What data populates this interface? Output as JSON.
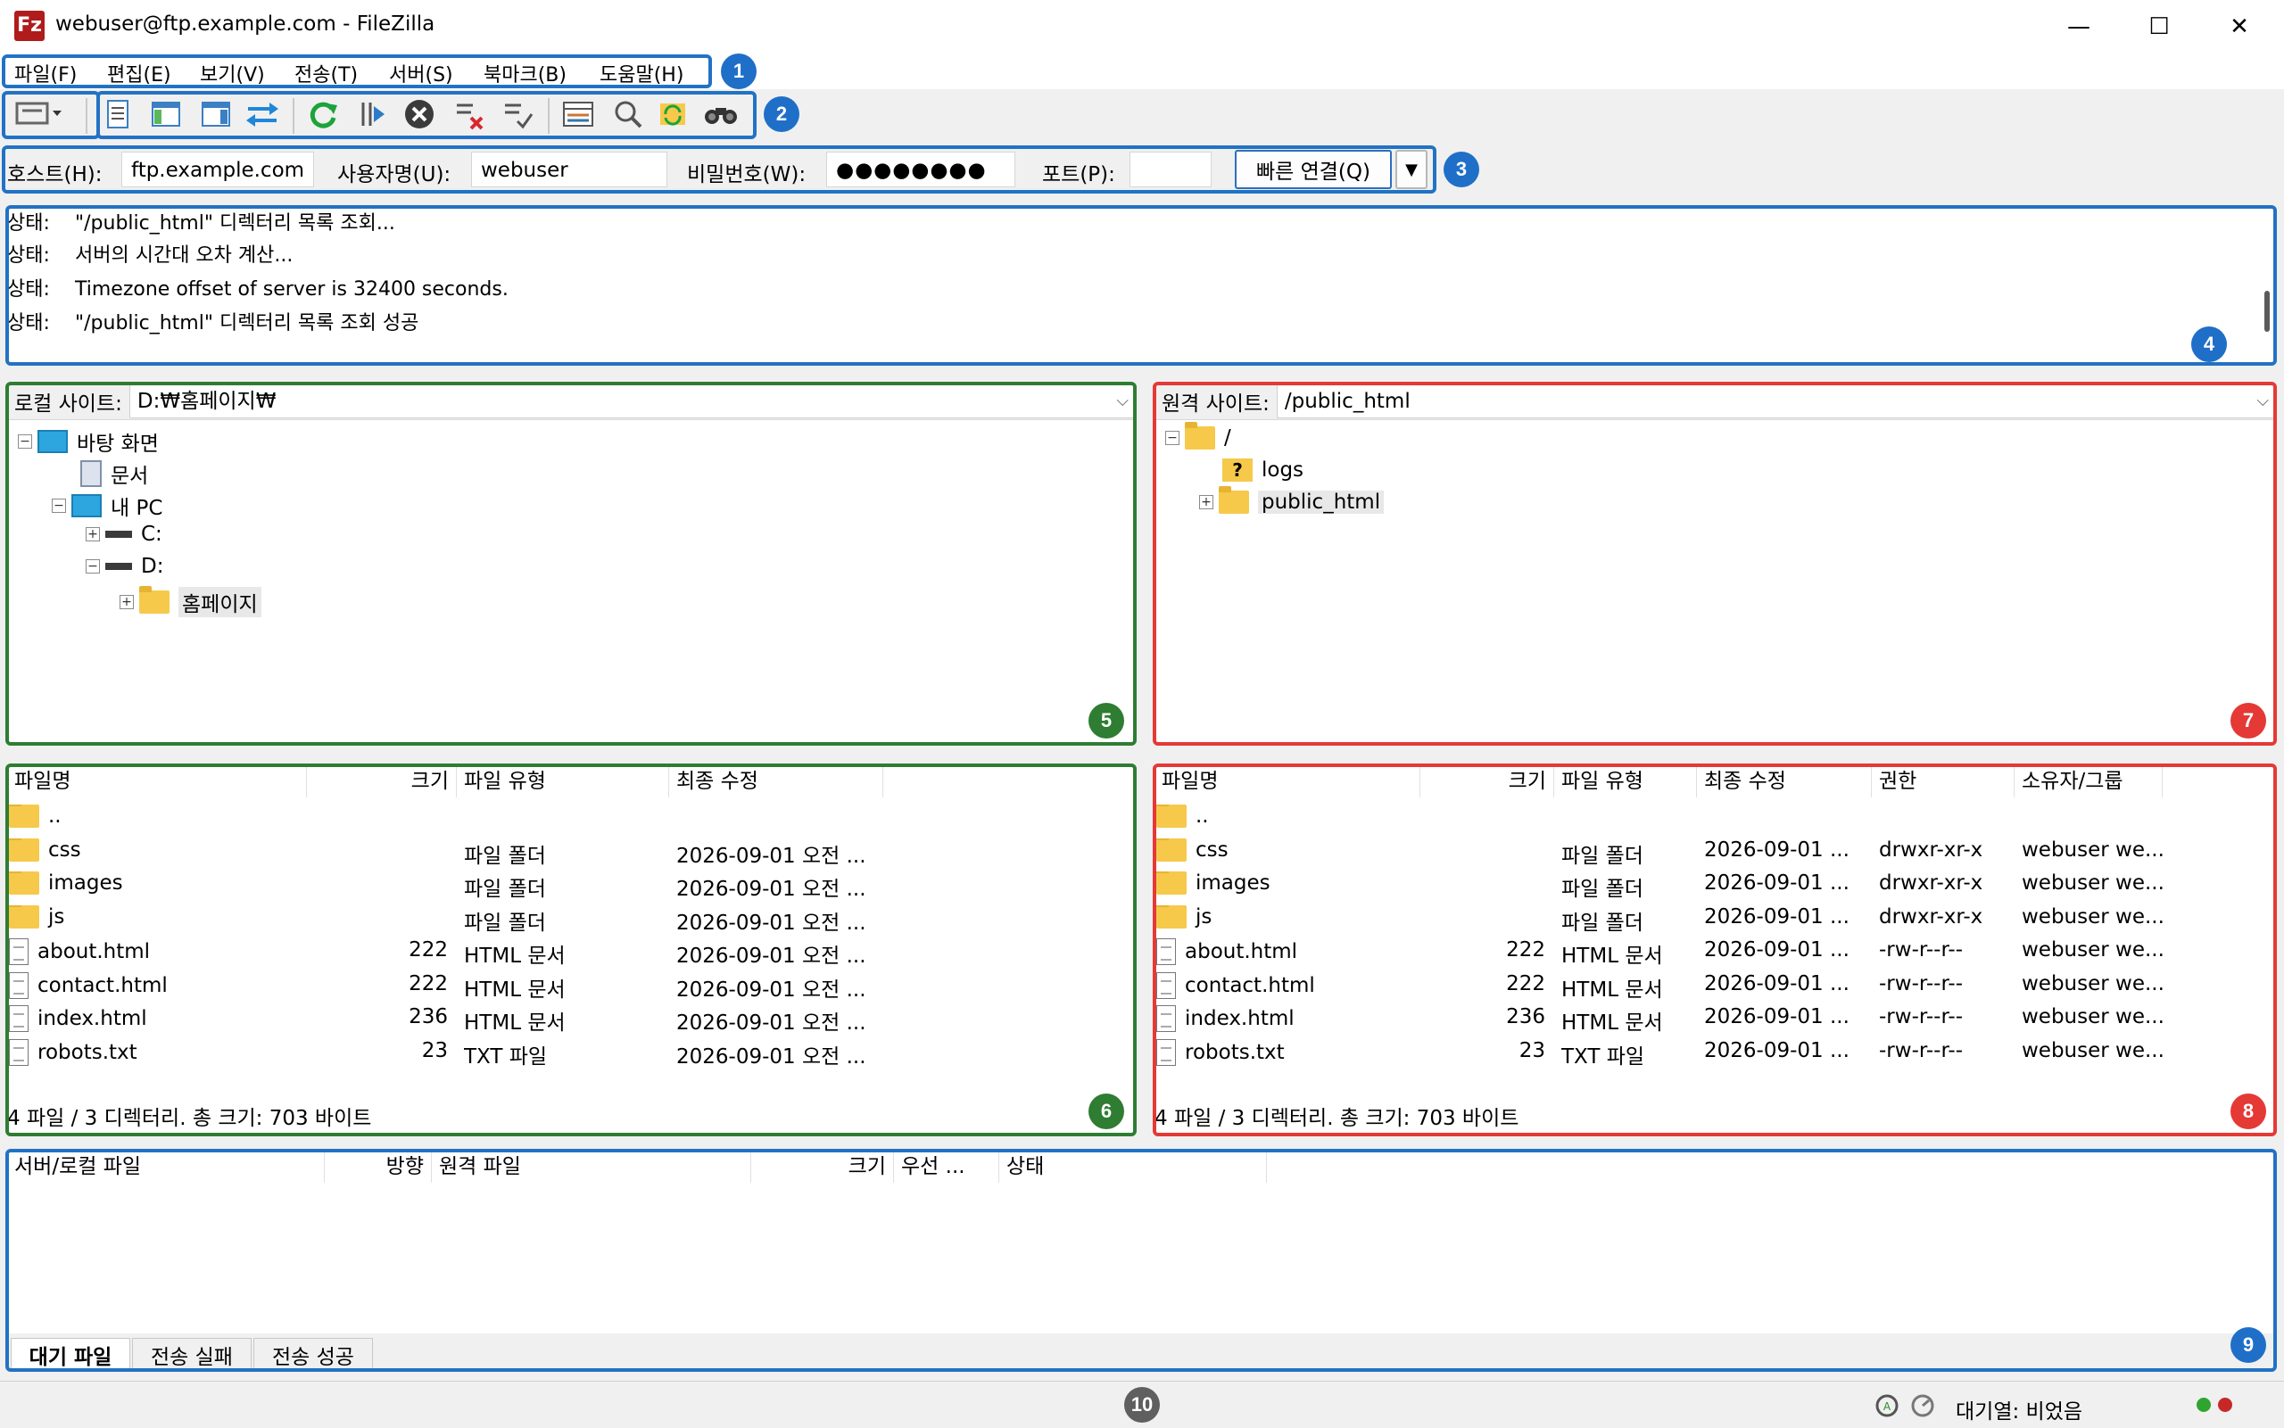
{
  "window": {
    "title": "webuser@ftp.example.com - FileZilla",
    "app_icon": "Fz",
    "minimize": "—",
    "maximize": "☐",
    "close": "✕"
  },
  "menu": [
    "파일(F)",
    "편집(E)",
    "보기(V)",
    "전송(T)",
    "서버(S)",
    "북마크(B)",
    "도움말(H)"
  ],
  "quickconnect": {
    "host_label": "호스트(H):",
    "host_value": "ftp.example.com",
    "user_label": "사용자명(U):",
    "user_value": "webuser",
    "pass_label": "비밀번호(W):",
    "pass_value": "●●●●●●●●",
    "port_label": "포트(P):",
    "port_value": "",
    "connect_label": "빠른 연결(Q)",
    "dropdown": "▼"
  },
  "log": [
    {
      "label": "상태:",
      "text": "\"/public_html\" 디렉터리 목록 조회..."
    },
    {
      "label": "상태:",
      "text": "서버의 시간대 오차 계산..."
    },
    {
      "label": "상태:",
      "text": "Timezone offset of server is 32400 seconds."
    },
    {
      "label": "상태:",
      "text": "\"/public_html\" 디렉터리 목록 조회 성공"
    }
  ],
  "local": {
    "site_label": "로컬 사이트:",
    "path": "D:₩홈페이지₩",
    "tree": [
      "바탕 화면",
      "문서",
      "내 PC",
      "C:",
      "D:",
      "홈페이지"
    ],
    "columns": [
      "파일명",
      "크기",
      "파일 유형",
      "최종 수정"
    ],
    "files": [
      {
        "name": "..",
        "size": "",
        "type": "",
        "modified": ""
      },
      {
        "name": "css",
        "size": "",
        "type": "파일 폴더",
        "modified": "2026-09-01 오전 ..."
      },
      {
        "name": "images",
        "size": "",
        "type": "파일 폴더",
        "modified": "2026-09-01 오전 ..."
      },
      {
        "name": "js",
        "size": "",
        "type": "파일 폴더",
        "modified": "2026-09-01 오전 ..."
      },
      {
        "name": "about.html",
        "size": "222",
        "type": "HTML 문서",
        "modified": "2026-09-01 오전 ..."
      },
      {
        "name": "contact.html",
        "size": "222",
        "type": "HTML 문서",
        "modified": "2026-09-01 오전 ..."
      },
      {
        "name": "index.html",
        "size": "236",
        "type": "HTML 문서",
        "modified": "2026-09-01 오전 ..."
      },
      {
        "name": "robots.txt",
        "size": "23",
        "type": "TXT 파일",
        "modified": "2026-09-01 오전 ..."
      }
    ],
    "status": "4 파일 / 3 디렉터리. 총 크기: 703 바이트"
  },
  "remote": {
    "site_label": "원격 사이트:",
    "path": "/public_html",
    "tree": [
      "/",
      "logs",
      "public_html"
    ],
    "columns": [
      "파일명",
      "크기",
      "파일 유형",
      "최종 수정",
      "권한",
      "소유자/그룹"
    ],
    "files": [
      {
        "name": "..",
        "size": "",
        "type": "",
        "modified": "",
        "perm": "",
        "owner": ""
      },
      {
        "name": "css",
        "size": "",
        "type": "파일 폴더",
        "modified": "2026-09-01 ...",
        "perm": "drwxr-xr-x",
        "owner": "webuser we..."
      },
      {
        "name": "images",
        "size": "",
        "type": "파일 폴더",
        "modified": "2026-09-01 ...",
        "perm": "drwxr-xr-x",
        "owner": "webuser we..."
      },
      {
        "name": "js",
        "size": "",
        "type": "파일 폴더",
        "modified": "2026-09-01 ...",
        "perm": "drwxr-xr-x",
        "owner": "webuser we..."
      },
      {
        "name": "about.html",
        "size": "222",
        "type": "HTML 문서",
        "modified": "2026-09-01 ...",
        "perm": "-rw-r--r--",
        "owner": "webuser we..."
      },
      {
        "name": "contact.html",
        "size": "222",
        "type": "HTML 문서",
        "modified": "2026-09-01 ...",
        "perm": "-rw-r--r--",
        "owner": "webuser we..."
      },
      {
        "name": "index.html",
        "size": "236",
        "type": "HTML 문서",
        "modified": "2026-09-01 ...",
        "perm": "-rw-r--r--",
        "owner": "webuser we..."
      },
      {
        "name": "robots.txt",
        "size": "23",
        "type": "TXT 파일",
        "modified": "2026-09-01 ...",
        "perm": "-rw-r--r--",
        "owner": "webuser we..."
      }
    ],
    "status": "4 파일 / 3 디렉터리. 총 크기: 703 바이트"
  },
  "queue": {
    "columns": [
      "서버/로컬 파일",
      "방향",
      "원격 파일",
      "크기",
      "우선 ...",
      "상태"
    ],
    "tabs": [
      "대기 파일",
      "전송 실패",
      "전송 성공"
    ]
  },
  "statusbar": {
    "queue_text": "대기열: 비었음"
  },
  "callouts": [
    "1",
    "2",
    "3",
    "4",
    "5",
    "6",
    "7",
    "8",
    "9",
    "10"
  ],
  "colors": {
    "blue": "#2272c4",
    "green": "#2e7d32",
    "red": "#e53935"
  }
}
